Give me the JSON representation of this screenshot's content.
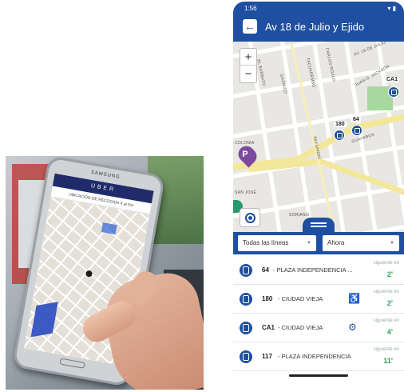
{
  "photo": {
    "phone_brand": "SAMSUNG",
    "app_brand": "UBER",
    "location_header": "UBICACIÓN DE RECOGIDA",
    "location_value": "Ir al Pin"
  },
  "app": {
    "status_time": "1:56",
    "status_icons": "▾ ▮",
    "title": "Av 18 de Julio y Ejido",
    "back_icon": "arrow-left-icon",
    "colors": {
      "primary": "#1f4fa0",
      "accent_green": "#2ea44f",
      "poi_purple": "#7b4a9c"
    },
    "map": {
      "zoom_in": "+",
      "zoom_out": "−",
      "poi_parking": "P",
      "stop_labels": [
        "CA1",
        "64",
        "180"
      ],
      "streets": [
        "AV. 18 DE JULIO",
        "CARLOS ROXLO",
        "TACUAREMBÓ",
        "GAZNIZZI",
        "PAYSANDÚ",
        "GUAYABOS",
        "COLONIA",
        "SAN JOSÉ",
        "SORIANO",
        "JUAN D. JACKSON",
        "EL BARBATO"
      ]
    },
    "filters": {
      "lines": "Todas las líneas",
      "time": "Ahora"
    },
    "next_label": "siguiente en",
    "rows": [
      {
        "number": "64",
        "destination": "- PLAZA INDEPENDENCIA ...",
        "next": "2'",
        "access": ""
      },
      {
        "number": "180",
        "destination": "- CIUDAD VIEJA",
        "next": "2'",
        "access": "♿"
      },
      {
        "number": "CA1",
        "destination": "- CIUDAD VIEJA",
        "next": "4'",
        "access": "⚙"
      },
      {
        "number": "117",
        "destination": "- PLAZA INDEPENDENCIA",
        "next": "11'",
        "access": ""
      }
    ]
  }
}
